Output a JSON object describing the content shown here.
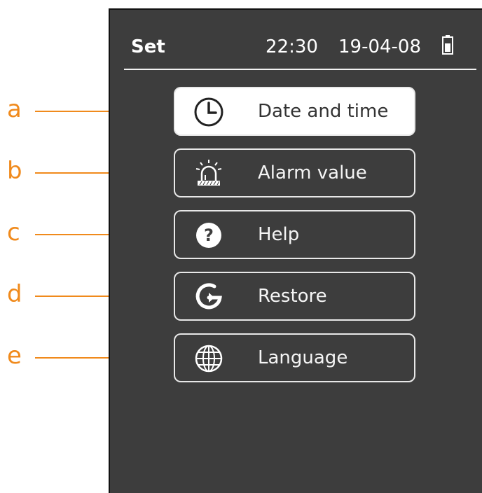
{
  "header": {
    "title": "Set",
    "time": "22:30",
    "date": "19-04-08"
  },
  "menu": {
    "items": [
      {
        "label": "Date and time",
        "icon": "clock-icon",
        "selected": true
      },
      {
        "label": "Alarm value",
        "icon": "alarm-siren-icon",
        "selected": false
      },
      {
        "label": "Help",
        "icon": "help-icon",
        "selected": false
      },
      {
        "label": "Restore",
        "icon": "restore-icon",
        "selected": false
      },
      {
        "label": "Language",
        "icon": "globe-icon",
        "selected": false
      }
    ]
  },
  "callouts": [
    "a",
    "b",
    "c",
    "d",
    "e"
  ],
  "colors": {
    "screen_bg": "#3d3d3d",
    "callout": "#f08a1c",
    "selected_bg": "#ffffff"
  }
}
